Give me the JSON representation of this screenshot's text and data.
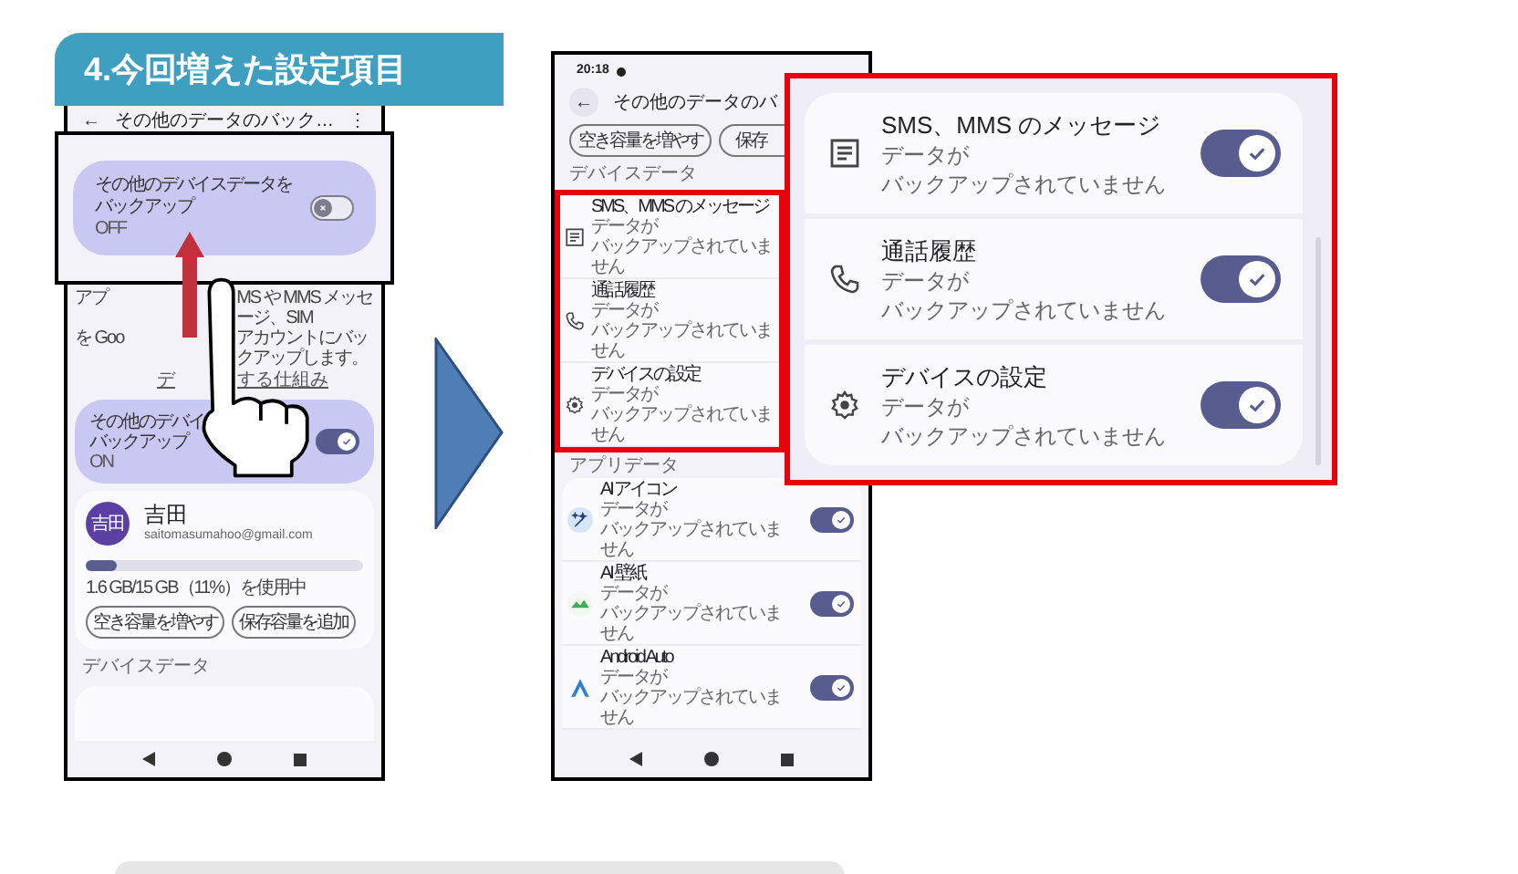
{
  "heading": "4.今回増えた設定項目",
  "left_phone": {
    "back_glyph": "←",
    "title": "その他のデータのバック…",
    "menu_glyph": "⋮",
    "callout": {
      "title_lines": [
        "その他のデバイスデータを",
        "バックアップ"
      ],
      "status": "OFF",
      "on": false
    },
    "description_left": [
      "アプ",
      "を Goo"
    ],
    "description_right": [
      "MS や MMS メッセージ、SIM",
      "アカウントにバックアップします。"
    ],
    "link_fragments": [
      "デ",
      "する仕組み"
    ],
    "setting": {
      "title_lines": [
        "その他のデバイ",
        "バックアップ"
      ],
      "status": "ON",
      "on": true
    },
    "account": {
      "avatar": "吉田",
      "name": "吉田",
      "email": "saitomasumahoo@gmail.com",
      "storage": {
        "level": 0.11,
        "reading": "1.6 GB/15 GB（11%）を使用中"
      },
      "buttons": [
        "空き容量を増やす",
        "保存容量を追加"
      ]
    },
    "section": "デバイスデータ"
  },
  "right_phone": {
    "time": "20:18",
    "back_glyph": "←",
    "title": "その他のデータのバ",
    "buttons": [
      "空き容量を増やす",
      "保存"
    ],
    "device_section": "デバイスデータ",
    "device_items": [
      {
        "kind": "messages",
        "title": "SMS、MMS のメッセージ",
        "subtitle_lines": [
          "データが",
          "バックアップされていません"
        ]
      },
      {
        "kind": "calls",
        "title": "通話履歴",
        "subtitle_lines": [
          "データが",
          "バックアップされていません"
        ]
      },
      {
        "kind": "settings",
        "title": "デバイスの設定",
        "subtitle_lines": [
          "データが",
          "バックアップされていません"
        ]
      }
    ],
    "app_section": "アプリデータ",
    "app_items": [
      {
        "kind": "ai_icon",
        "title": "AI アイコン",
        "subtitle_lines": [
          "データが",
          "バックアップされていません"
        ],
        "on": true
      },
      {
        "kind": "ai_wallpaper",
        "title": "AI 壁紙",
        "subtitle_lines": [
          "データが",
          "バックアップされていません"
        ],
        "on": true
      },
      {
        "kind": "android_auto",
        "title": "Android Auto",
        "subtitle_lines": [
          "データが",
          "バックアップされていません"
        ],
        "on": true
      }
    ]
  },
  "zoom_panel": {
    "items": [
      {
        "kind": "messages",
        "title": "SMS、MMS のメッセージ",
        "subtitle_lines": [
          "データが",
          "バックアップされていません"
        ],
        "on": true
      },
      {
        "kind": "calls",
        "title": "通話履歴",
        "subtitle_lines": [
          "データが",
          "バックアップされていません"
        ],
        "on": true
      },
      {
        "kind": "settings",
        "title": "デバイスの設定",
        "subtitle_lines": [
          "データが",
          "バックアップされていません"
        ],
        "on": true
      }
    ]
  }
}
